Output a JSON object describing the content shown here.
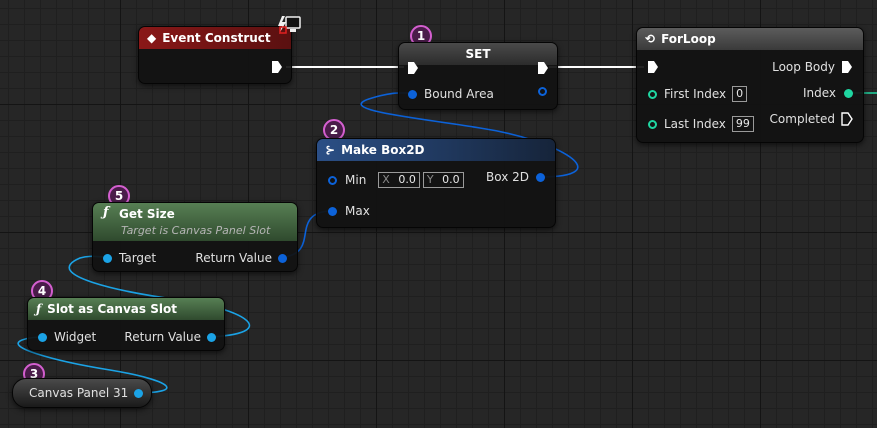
{
  "nodes": {
    "event_construct": {
      "title": "Event Construct"
    },
    "set": {
      "title": "SET",
      "pin_bound_area": "Bound Area",
      "badge": "1"
    },
    "forloop": {
      "title": "ForLoop",
      "pin_first_index": "First Index",
      "first_index_value": "0",
      "pin_last_index": "Last Index",
      "last_index_value": "99",
      "pin_loop_body": "Loop Body",
      "pin_index": "Index",
      "pin_completed": "Completed"
    },
    "make_box2d": {
      "title": "Make Box2D",
      "badge": "2",
      "pin_min": "Min",
      "x_label": "X",
      "x_value": "0.0",
      "y_label": "Y",
      "y_value": "0.0",
      "pin_max": "Max",
      "pin_box2d": "Box 2D"
    },
    "get_size": {
      "title": "Get Size",
      "subtitle": "Target is Canvas Panel Slot",
      "badge": "5",
      "pin_target": "Target",
      "pin_return": "Return Value"
    },
    "slot_as_canvas_slot": {
      "title": "Slot as Canvas Slot",
      "badge": "4",
      "pin_widget": "Widget",
      "pin_return": "Return Value"
    },
    "canvas_panel": {
      "title": "Canvas Panel 31",
      "badge": "3"
    }
  },
  "colors": {
    "event_header": "#8a1818",
    "set_header": "#3a3a3a",
    "forloop_header": "#505050",
    "make_header": "#1e3a66",
    "pure_header": "#4e7a4c",
    "object_pin": "#1ba3e6",
    "struct_pin": "#0c62d9",
    "int_pin": "#1fd6a1",
    "badge": "#d45fd0"
  }
}
